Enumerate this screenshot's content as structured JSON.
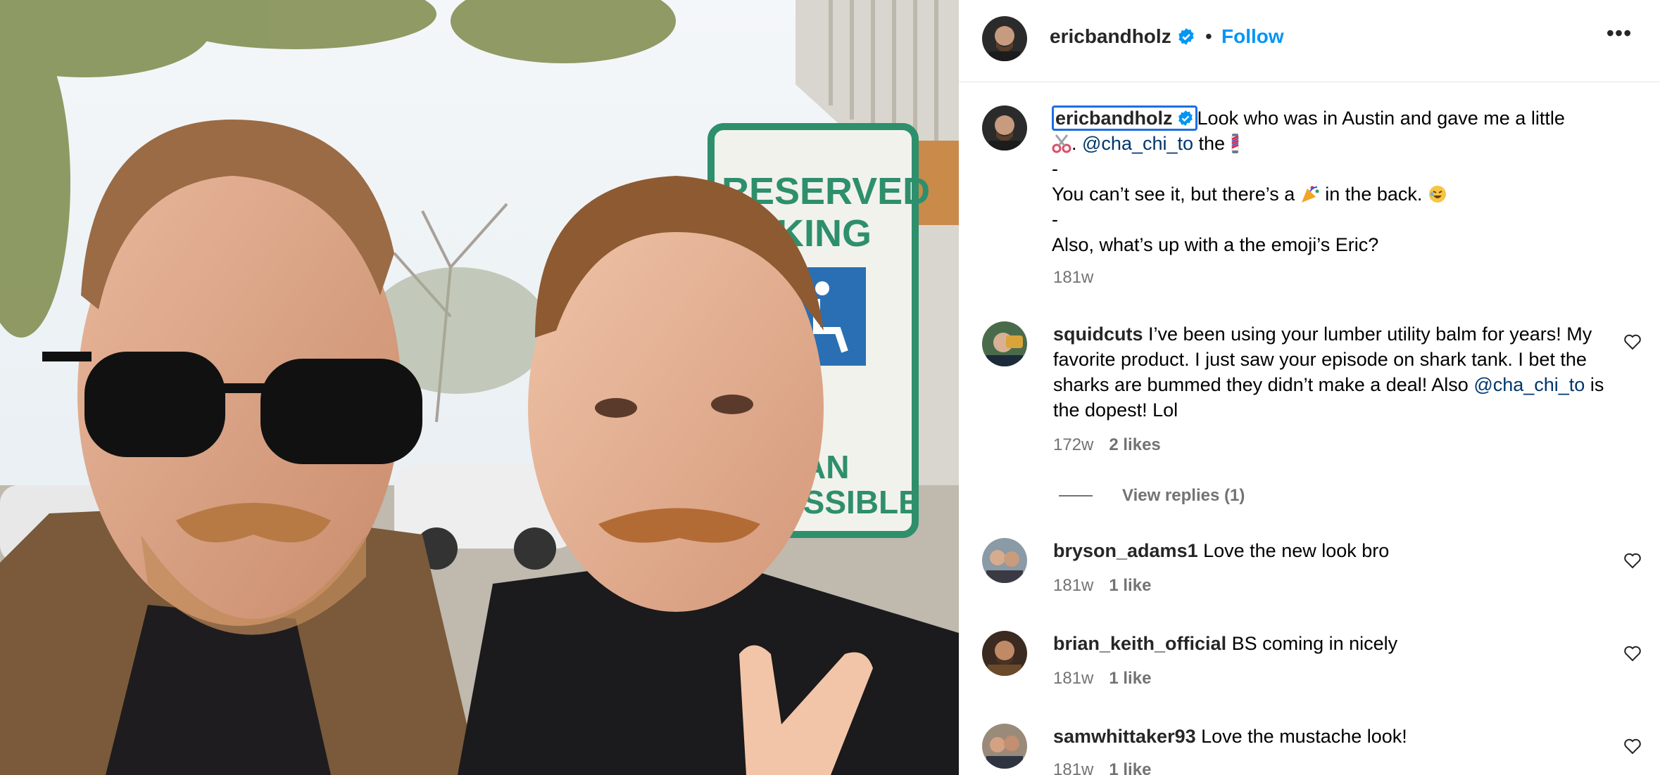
{
  "post": {
    "username": "ericbandholz",
    "follow_label": "Follow",
    "separator": "•",
    "more_label": "•••"
  },
  "caption": {
    "username": "ericbandholz",
    "line1": "Look who was in Austin and gave me a little",
    "line2_mention": "@cha_chi_to",
    "line2_after": " the",
    "line3": "-",
    "line4_before": "You can’t see it, but there’s a",
    "line4_after": "in the back.",
    "line5": "-",
    "line6": "Also, what’s up with a the emoji’s Eric?",
    "time": "181w"
  },
  "comments": [
    {
      "username": "squidcuts",
      "text_1": " I’ve been using your lumber utility balm for years! My favorite product. I just saw your episode on shark tank. I bet the sharks are bummed they didn’t make a deal! Also ",
      "mention": "@cha_chi_to",
      "text_2": " is the dopest! Lol",
      "time": "172w",
      "likes": "2 likes",
      "replies_label": "View replies (1)"
    },
    {
      "username": "bryson_adams1",
      "text": " Love the new look bro",
      "time": "181w",
      "likes": "1 like"
    },
    {
      "username": "brian_keith_official",
      "text": " BS coming in nicely",
      "time": "181w",
      "likes": "1 like"
    },
    {
      "username": "samwhittaker93",
      "text": " Love the mustache look!",
      "time": "181w",
      "likes": "1 like"
    }
  ],
  "icons": {
    "verified": "verified-badge-icon",
    "heart": "heart-outline-icon",
    "more": "more-horizontal-icon",
    "scissors": "scissors-emoji",
    "barber_pole": "barber-pole-emoji",
    "party": "party-popper-emoji",
    "laughing": "rolling-laughing-emoji"
  },
  "colors": {
    "link_blue": "#0095f6",
    "mention_blue": "#00376b",
    "secondary_text": "#737373",
    "verified_blue": "#0095f6"
  }
}
